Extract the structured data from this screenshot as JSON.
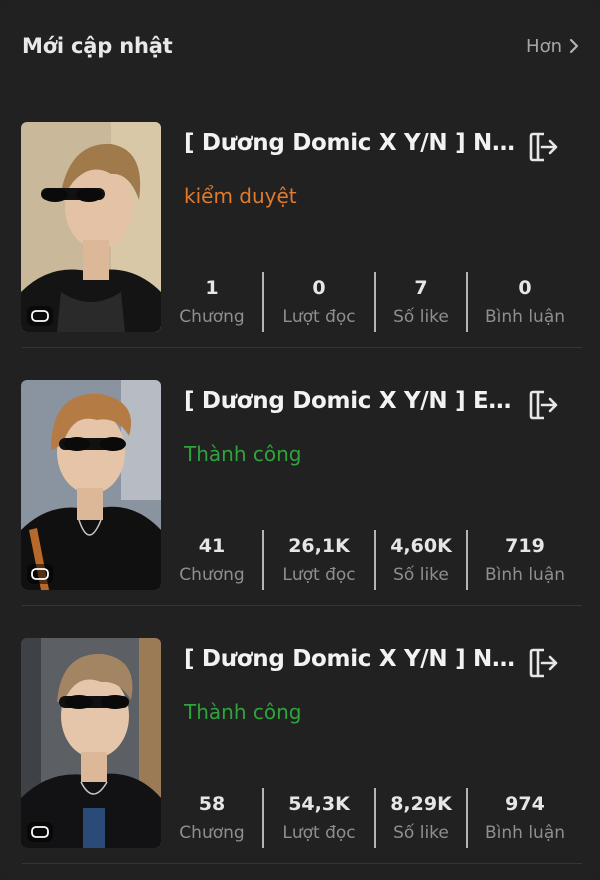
{
  "header": {
    "title": "Mới cập nhật",
    "more_label": "Hơn"
  },
  "stat_labels": {
    "chapters": "Chương",
    "reads": "Lượt đọc",
    "likes": "Số like",
    "comments": "Bình luận"
  },
  "stories": [
    {
      "title": "[ Dương Domic X Y/N ] Nuôi...",
      "status": "kiểm duyệt",
      "status_type": "pending",
      "chapters": "1",
      "reads": "0",
      "likes": "7",
      "comments": "0"
    },
    {
      "title": "[ Dương Domic X Y/N ] Em ...",
      "status": "Thành công",
      "status_type": "success",
      "chapters": "41",
      "reads": "26,1K",
      "likes": "4,60K",
      "comments": "719"
    },
    {
      "title": "[ Dương Domic X Y/N ] Nuôi...",
      "status": "Thành công",
      "status_type": "success",
      "chapters": "58",
      "reads": "54,3K",
      "likes": "8,29K",
      "comments": "974"
    }
  ],
  "icons": {
    "more": "chevron-right-icon",
    "export": "export-icon",
    "cover_badge": "book-badge-icon"
  },
  "colors": {
    "background": "#212121",
    "status_pending": "#e07a2c",
    "status_success": "#2ea43c"
  }
}
